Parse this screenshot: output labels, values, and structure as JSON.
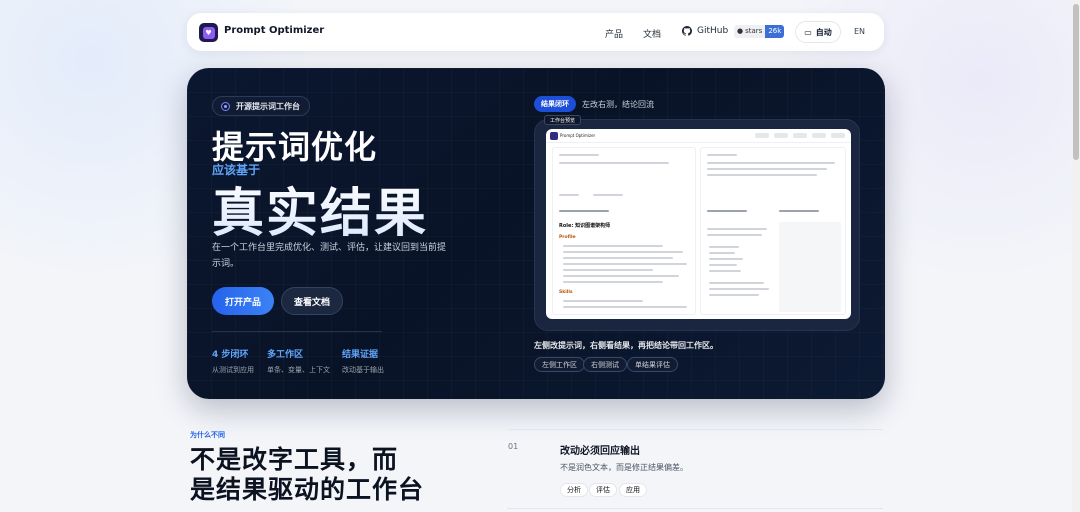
{
  "nav": {
    "brand": "Prompt Optimizer",
    "links": [
      "产品",
      "文档"
    ],
    "github_label": "GitHub",
    "stars_label": "stars",
    "stars_count": "26k",
    "theme_label": "自动",
    "lang_label": "EN"
  },
  "hero": {
    "pill": "开源提示词工作台",
    "title_line1": "提示词优化",
    "title_small": "应该基于",
    "title_big": "真实结果",
    "description": "在一个工作台里完成优化、测试、评估，让建议回到当前提示词。",
    "primary_button": "打开产品",
    "secondary_button": "查看文档",
    "stats": [
      {
        "title": "4 步闭环",
        "desc": "从测试到应用"
      },
      {
        "title": "多工作区",
        "desc": "单条、变量、上下文"
      },
      {
        "title": "结果证据",
        "desc": "改动基于输出"
      }
    ],
    "loop_tag": "结果闭环",
    "loop_caption": "左改右测，结论回流",
    "shot_badge": "工作台预览",
    "shot_heading_left": "Role: 知识图谱架构师",
    "shot_subheading_left": "Profile",
    "shot_skills": "Skills",
    "caption": "左侧改提示词，右侧看结果，再把结论带回工作区。",
    "chips": [
      "左侧工作区",
      "右侧测试",
      "单结果评估"
    ]
  },
  "section": {
    "eyebrow": "为什么不同",
    "headline_line1": "不是改字工具，而",
    "headline_line2": "是结果驱动的工作台",
    "feature": {
      "number": "01",
      "title": "改动必须回应输出",
      "desc": "不是润色文本，而是修正结果偏差。",
      "chips": [
        "分析",
        "评估",
        "应用"
      ]
    }
  },
  "colors": {
    "accent": "#2563eb",
    "hero_bg": "#0a152b",
    "highlight": "#60a5fa"
  }
}
